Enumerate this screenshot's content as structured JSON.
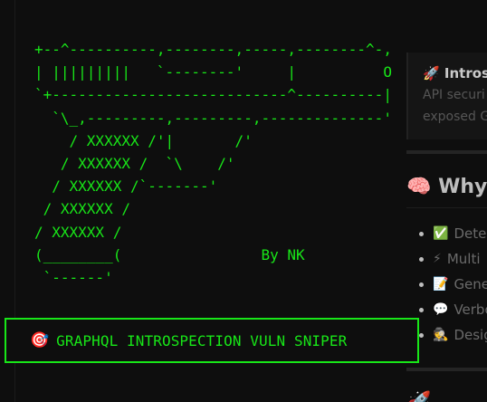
{
  "ascii_art": "+--^----------,--------,-----,--------^-,\n| |||||||||   `--------'     |          O\n`+---------------------------^----------|\n  `\\_,---------,---------,--------------'\n    / XXXXXX /'|       /'\n   / XXXXXX /  `\\    /'\n  / XXXXXX /`-------'\n / XXXXXX /\n/ XXXXXX /\n(________(                By NK\n `------'",
  "banner": {
    "icon": "🎯",
    "text": "GRAPHQL INTROSPECTION VULN SNIPER"
  },
  "right_pane": {
    "card": {
      "icon": "🚀",
      "title": "Introsp",
      "line1": "API securi",
      "line2": "exposed G"
    },
    "section_heading": {
      "icon": "🧠",
      "text": "Why"
    },
    "features": [
      {
        "icon": "✅",
        "text": "Dete"
      },
      {
        "icon": "⚡",
        "text": "Multi"
      },
      {
        "icon": "📝",
        "text": "Gene"
      },
      {
        "icon": "💬",
        "text": "Verbo"
      },
      {
        "icon": "🕵",
        "text": "Desig"
      }
    ],
    "bottom_heading": {
      "icon": "🚀",
      "text": ""
    }
  }
}
